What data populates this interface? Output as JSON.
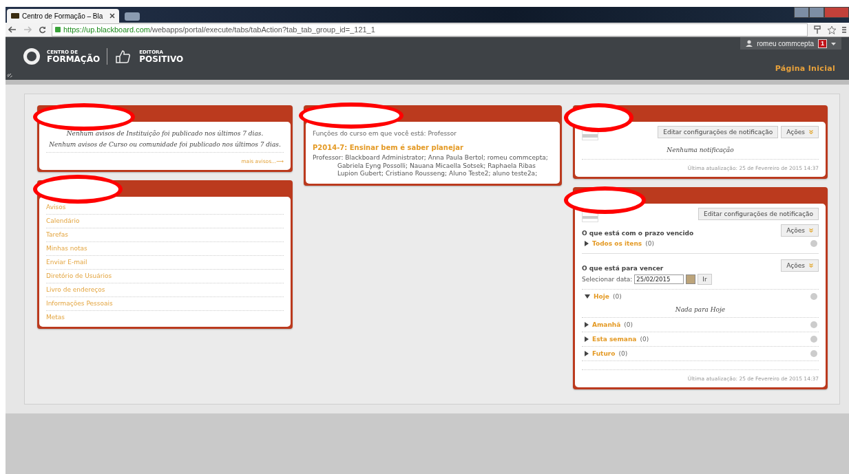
{
  "browser": {
    "tab_title": "Centro de Formação – Bla",
    "url_host": "https://up.blackboard.com",
    "url_path": "/webapps/portal/execute/tabs/tabAction?tab_tab_group_id=_121_1"
  },
  "header": {
    "logo_line1": "CENTRO DE",
    "logo_line2": "FORMAÇÃO",
    "partner_line1": "EDITORA",
    "partner_line2": "POSITIVO",
    "user": "romeu commcepta",
    "badge": "1",
    "nav_tabs": [
      {
        "label": "Página Inicial",
        "selected": true
      }
    ]
  },
  "columns": [
    {
      "modules": [
        {
          "kind": "announcements",
          "redacted": true,
          "lines": [
            "Nenhum avisos de Instituição foi publicado nos últimos 7 dias.",
            "Nenhum avisos de Curso ou comunidade foi publicado nos últimos 7 dias."
          ],
          "more_link": "mais avisos...",
          "more_arrow": "⟶"
        },
        {
          "kind": "tools",
          "redacted": true,
          "items": [
            "Avisos",
            "Calendário",
            "Tarefas",
            "Minhas notas",
            "Enviar E-mail",
            "Diretório de Usuários",
            "Livro de endereços",
            "Informações Pessoais",
            "Metas"
          ]
        }
      ]
    },
    {
      "modules": [
        {
          "kind": "courses",
          "redacted": true,
          "roles": "Funções do curso em que você está: Professor",
          "courses": [
            {
              "title": "P2014-7: Ensinar bem é saber planejar",
              "role_label": "Professor:",
              "members": "Blackboard Administrator;  Anna Paula Bertol;  romeu commcepta;  Gabriela Eyng Possolli;  Nauana Micaella Sotsek;  Raphaela Ribas Lupion Gubert;  Cristiano Rousseng;  Aluno Teste2;  aluno teste2a;"
            }
          ]
        }
      ]
    },
    {
      "modules": [
        {
          "kind": "notifications",
          "redacted": true,
          "edit_button": "Editar configurações de notificação",
          "actions_button": "Ações",
          "empty": "Nenhuma notificação",
          "updated": "Última atualização: 25 de Fevereiro de 2015 14:37"
        },
        {
          "kind": "due",
          "redacted": true,
          "edit_button": "Editar configurações de notificação",
          "sections": [
            {
              "title": "O que está com o prazo vencido",
              "actions_button": "Ações",
              "items": [
                {
                  "label": "Todos os itens",
                  "count": "(0)",
                  "expanded": false
                }
              ]
            },
            {
              "title": "O que está para vencer",
              "actions_button": "Ações",
              "date_label": "Selecionar data:",
              "date_value": "25/02/2015",
              "go_button": "Ir",
              "items": [
                {
                  "label": "Hoje",
                  "count": "(0)",
                  "expanded": true,
                  "empty": "Nada para Hoje"
                },
                {
                  "label": "Amanhã",
                  "count": "(0)",
                  "expanded": false
                },
                {
                  "label": "Esta semana",
                  "count": "(0)",
                  "expanded": false
                },
                {
                  "label": "Futuro",
                  "count": "(0)",
                  "expanded": false
                }
              ]
            }
          ],
          "updated": "Última atualização: 25 de Fevereiro de 2015 14:37"
        }
      ]
    }
  ]
}
